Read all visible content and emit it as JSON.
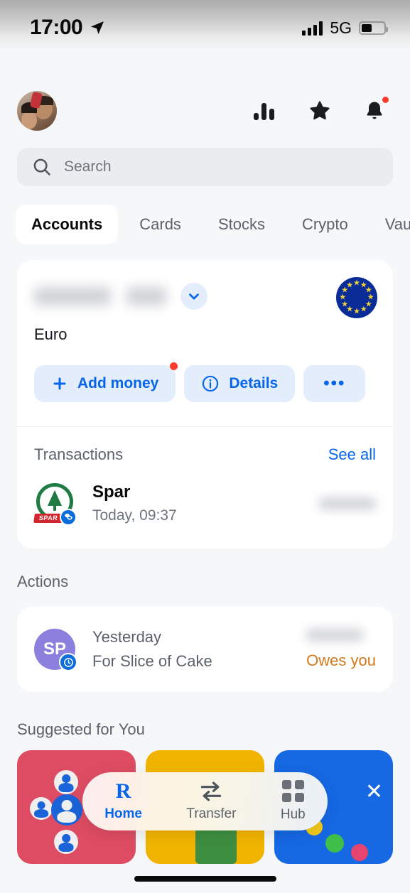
{
  "status_bar": {
    "time": "17:00",
    "location_icon": "location-arrow-icon",
    "signal_icon": "signal-bars-icon",
    "network": "5G",
    "battery_icon": "battery-icon"
  },
  "header": {
    "avatar": "profile-avatar",
    "icons": [
      {
        "name": "analytics-icon",
        "label": "Analytics"
      },
      {
        "name": "star-icon",
        "label": "Favourites"
      },
      {
        "name": "bell-icon",
        "label": "Notifications",
        "has_badge": true
      }
    ]
  },
  "search": {
    "placeholder": "Search",
    "icon": "search-icon",
    "value": ""
  },
  "tabs": [
    {
      "label": "Accounts",
      "active": true
    },
    {
      "label": "Cards",
      "active": false
    },
    {
      "label": "Stocks",
      "active": false
    },
    {
      "label": "Crypto",
      "active": false
    },
    {
      "label": "Vaul",
      "active": false
    }
  ],
  "account": {
    "balance": "",
    "balance_hidden": true,
    "currency": "Euro",
    "flag": "eu-flag-icon",
    "expand_icon": "chevron-down-icon",
    "buttons": [
      {
        "label": "Add money",
        "icon": "plus-icon",
        "badge": true
      },
      {
        "label": "Details",
        "icon": "info-icon",
        "badge": false
      },
      {
        "label": "•••",
        "icon": "more-icon",
        "badge": false
      }
    ]
  },
  "transactions": {
    "title": "Transactions",
    "see_all": "See all",
    "items": [
      {
        "merchant": "Spar",
        "logo": "spar-logo-icon",
        "badge_icon": "coins-icon",
        "subtitle": "Today, 09:37",
        "amount": "",
        "amount_hidden": true
      }
    ]
  },
  "actions": {
    "title": "Actions",
    "items": [
      {
        "initials": "SP",
        "avatar_color": "#8B80DE",
        "badge_icon": "clock-icon",
        "line1": "Yesterday",
        "line2": "For Slice of Cake",
        "amount": "",
        "amount_hidden": true,
        "status": "Owes you",
        "status_color": "#D4791C"
      }
    ]
  },
  "suggested": {
    "title": "Suggested for You",
    "cards": [
      {
        "name": "invite-friends-card",
        "color": "#DE4C63",
        "art": "people-group-icon"
      },
      {
        "name": "travel-card",
        "color": "#F0B400",
        "art": "shopping-bag-icon"
      },
      {
        "name": "rewards-card",
        "color": "#1668E3",
        "art": "colorful-balls-icon",
        "close_label": "✕"
      }
    ]
  },
  "bottom_nav": [
    {
      "label": "Home",
      "icon": "revolut-r-icon",
      "glyph": "R",
      "active": true
    },
    {
      "label": "Transfer",
      "icon": "transfer-arrows-icon",
      "active": false
    },
    {
      "label": "Hub",
      "icon": "grid-hub-icon",
      "active": false
    }
  ],
  "colors": {
    "accent_blue": "#0666EB",
    "badge_red": "#FC3B2D",
    "owes_orange": "#D4791C",
    "page_bg": "#F6F7F9",
    "card_bg": "#FFFFFF"
  }
}
